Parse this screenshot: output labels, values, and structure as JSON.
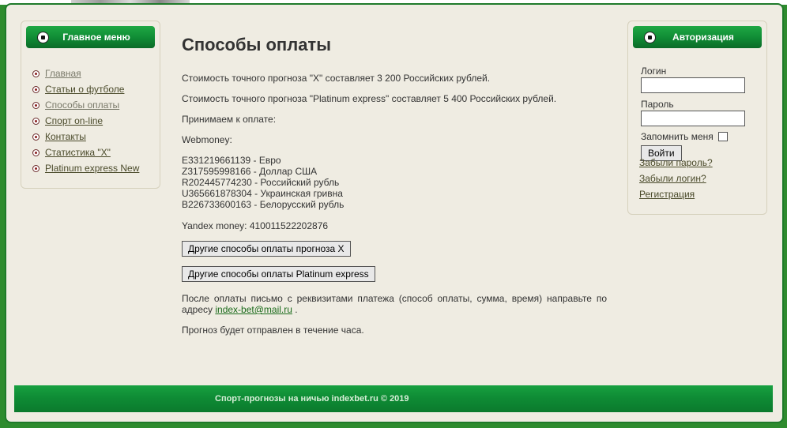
{
  "main_menu": {
    "title": "Главное меню",
    "items": [
      {
        "label": "Главная"
      },
      {
        "label": "Статьи о футболе"
      },
      {
        "label": "Способы оплаты"
      },
      {
        "label": "Спорт on-line"
      },
      {
        "label": "Контакты"
      },
      {
        "label": "Статистика \"X\""
      },
      {
        "label": "Platinum express New"
      }
    ]
  },
  "content": {
    "title": "Способы оплаты",
    "price_x": "Стоимость точного прогноза \"X\" составляет 3 200 Российских рублей.",
    "price_platinum": "Стоимость точного прогноза \"Platinum express\" составляет 5 400 Российских рублей.",
    "accept_label": "Принимаем к оплате:",
    "webmoney_label": "Webmoney:",
    "wallets": [
      "E331219661139 - Евро",
      "Z317595998166 - Доллар США",
      "R202445774230 - Российский рубль",
      "U365661878304 - Украинская гривна",
      "B226733600163 - Белорусский рубль"
    ],
    "yandex": "Yandex money: 410011522202876",
    "button_x": "Другие способы оплаты прогноза X",
    "button_platinum": "Другие способы оплаты Platinum express",
    "instructions_before": "После оплаты письмо с реквизитами платежа (способ оплаты, сумма, время) направьте  по адресу ",
    "email": "index-bet@mail.ru",
    "instructions_after": " .",
    "delivery_note": "Прогноз будет отправлен в течение часа."
  },
  "auth": {
    "title": "Авторизация",
    "login_label": "Логин",
    "password_label": "Пароль",
    "remember_label": "Запомнить меня",
    "submit_label": "Войти",
    "links": [
      {
        "label": "Забыли пароль?"
      },
      {
        "label": "Забыли логин?"
      },
      {
        "label": "Регистрация"
      }
    ]
  },
  "footer": {
    "text": "Спорт-прогнозы на ничью indexbet.ru © 2019"
  }
}
